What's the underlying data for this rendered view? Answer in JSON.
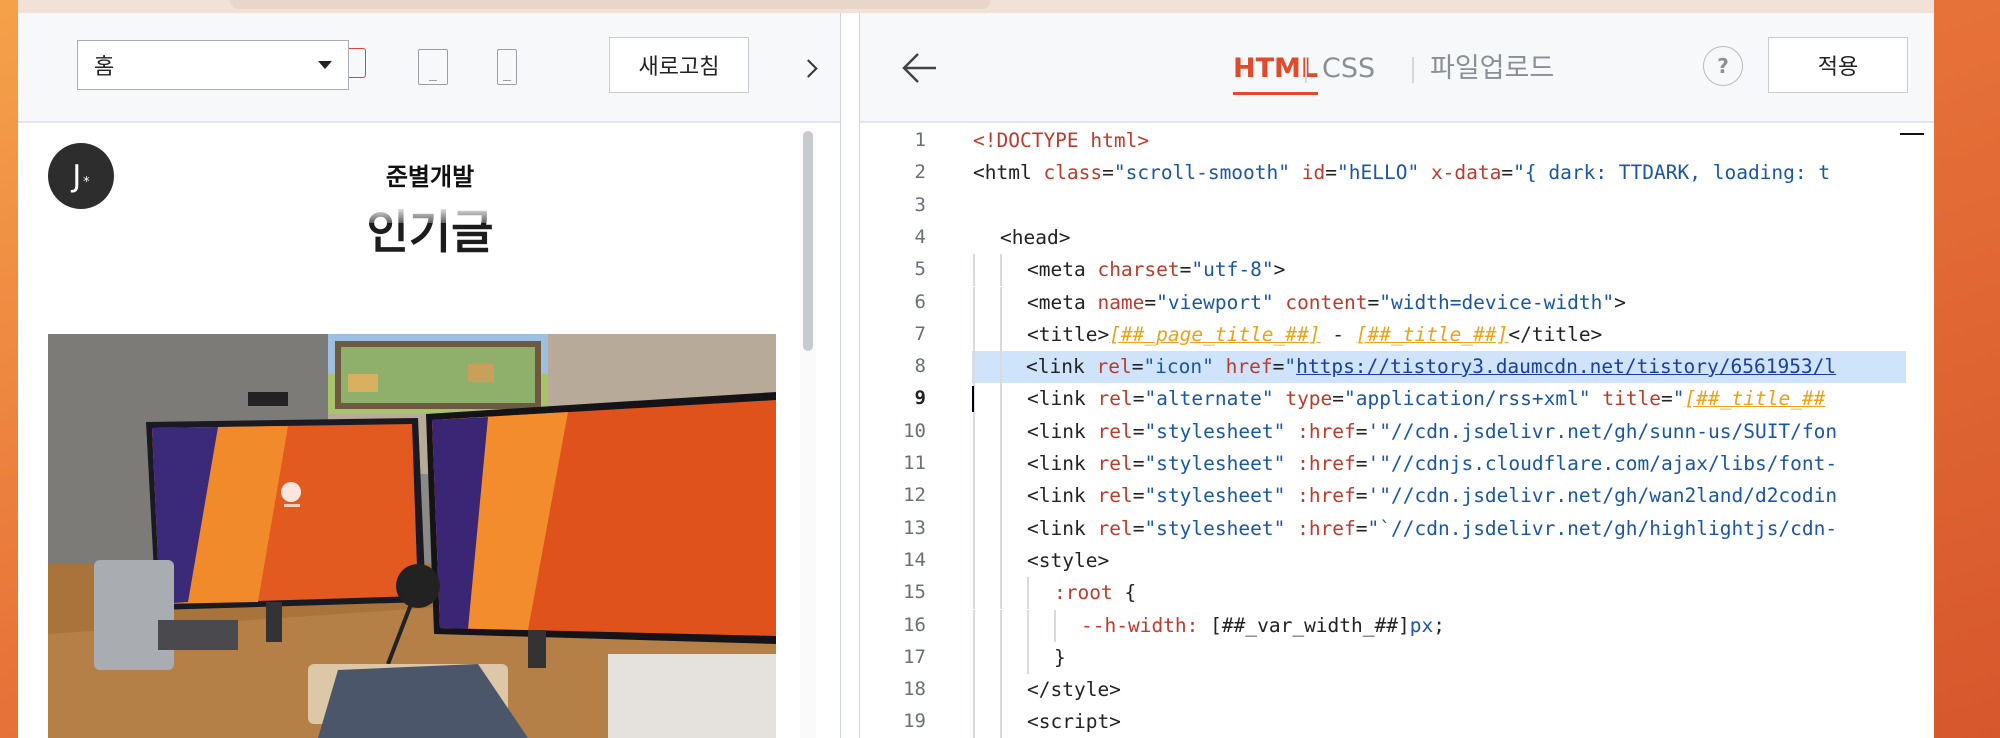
{
  "preview": {
    "page_select": "홈",
    "refresh_label": "새로고침",
    "avatar_text": "J",
    "avatar_sub": "*",
    "blog_title": "준별개발",
    "section_heading": "인기글"
  },
  "editor": {
    "tabs": [
      {
        "label": "HTML",
        "active": true
      },
      {
        "label": "CSS",
        "active": false
      },
      {
        "label": "파일업로드",
        "active": false
      }
    ],
    "help_label": "?",
    "apply_label": "적용",
    "active_line": 9,
    "highlight_line": 8,
    "lines": [
      {
        "n": 1,
        "indent": 0,
        "tokens": [
          [
            "doctype",
            "<!DOCTYPE html>"
          ]
        ]
      },
      {
        "n": 2,
        "indent": 0,
        "tokens": [
          [
            "tag",
            "<html "
          ],
          [
            "attr",
            "class"
          ],
          [
            "plain",
            "="
          ],
          [
            "str",
            "\"scroll-smooth\""
          ],
          [
            "plain",
            " "
          ],
          [
            "attr",
            "id"
          ],
          [
            "plain",
            "="
          ],
          [
            "str",
            "\"hELLO\""
          ],
          [
            "plain",
            " "
          ],
          [
            "attr",
            "x-data"
          ],
          [
            "plain",
            "="
          ],
          [
            "str",
            "\"{ dark: TTDARK, loading: t"
          ]
        ]
      },
      {
        "n": 3,
        "indent": 0,
        "tokens": []
      },
      {
        "n": 4,
        "indent": 1,
        "tokens": [
          [
            "tag",
            "<head>"
          ]
        ]
      },
      {
        "n": 5,
        "indent": 2,
        "tokens": [
          [
            "tag",
            "<meta "
          ],
          [
            "attr",
            "charset"
          ],
          [
            "plain",
            "="
          ],
          [
            "str",
            "\"utf-8\""
          ],
          [
            "tag",
            ">"
          ]
        ]
      },
      {
        "n": 6,
        "indent": 2,
        "tokens": [
          [
            "tag",
            "<meta "
          ],
          [
            "attr",
            "name"
          ],
          [
            "plain",
            "="
          ],
          [
            "str",
            "\"viewport\""
          ],
          [
            "plain",
            " "
          ],
          [
            "attr",
            "content"
          ],
          [
            "plain",
            "="
          ],
          [
            "str",
            "\"width=device-width\""
          ],
          [
            "tag",
            ">"
          ]
        ]
      },
      {
        "n": 7,
        "indent": 2,
        "tokens": [
          [
            "tag",
            "<title>"
          ],
          [
            "tpl",
            "[##_page_title_##]"
          ],
          [
            "plain",
            " - "
          ],
          [
            "tpl",
            "[##_title_##]"
          ],
          [
            "tag",
            "</title>"
          ]
        ]
      },
      {
        "n": 8,
        "indent": 2,
        "tokens": [
          [
            "tag",
            "<link "
          ],
          [
            "attr",
            "rel"
          ],
          [
            "plain",
            "="
          ],
          [
            "str",
            "\"icon\""
          ],
          [
            "plain",
            " "
          ],
          [
            "attr",
            "href"
          ],
          [
            "plain",
            "="
          ],
          [
            "str",
            "\""
          ],
          [
            "link",
            "https://tistory3.daumcdn.net/tistory/6561953/l"
          ]
        ]
      },
      {
        "n": 9,
        "indent": 2,
        "tokens": [
          [
            "tag",
            "<link "
          ],
          [
            "attr",
            "rel"
          ],
          [
            "plain",
            "="
          ],
          [
            "str",
            "\"alternate\""
          ],
          [
            "plain",
            " "
          ],
          [
            "attr",
            "type"
          ],
          [
            "plain",
            "="
          ],
          [
            "str",
            "\"application/rss+xml\""
          ],
          [
            "plain",
            " "
          ],
          [
            "attr",
            "title"
          ],
          [
            "plain",
            "="
          ],
          [
            "str",
            "\""
          ],
          [
            "tpl",
            "[##_title_##"
          ]
        ]
      },
      {
        "n": 10,
        "indent": 2,
        "tokens": [
          [
            "tag",
            "<link "
          ],
          [
            "attr",
            "rel"
          ],
          [
            "plain",
            "="
          ],
          [
            "str",
            "\"stylesheet\""
          ],
          [
            "plain",
            " "
          ],
          [
            "attr",
            ":href"
          ],
          [
            "plain",
            "="
          ],
          [
            "str",
            "'\"//cdn.jsdelivr.net/gh/sunn-us/SUIT/fon"
          ]
        ]
      },
      {
        "n": 11,
        "indent": 2,
        "tokens": [
          [
            "tag",
            "<link "
          ],
          [
            "attr",
            "rel"
          ],
          [
            "plain",
            "="
          ],
          [
            "str",
            "\"stylesheet\""
          ],
          [
            "plain",
            " "
          ],
          [
            "attr",
            ":href"
          ],
          [
            "plain",
            "="
          ],
          [
            "str",
            "'\"//cdnjs.cloudflare.com/ajax/libs/font-"
          ]
        ]
      },
      {
        "n": 12,
        "indent": 2,
        "tokens": [
          [
            "tag",
            "<link "
          ],
          [
            "attr",
            "rel"
          ],
          [
            "plain",
            "="
          ],
          [
            "str",
            "\"stylesheet\""
          ],
          [
            "plain",
            " "
          ],
          [
            "attr",
            ":href"
          ],
          [
            "plain",
            "="
          ],
          [
            "str",
            "'\"//cdn.jsdelivr.net/gh/wan2land/d2codin"
          ]
        ]
      },
      {
        "n": 13,
        "indent": 2,
        "tokens": [
          [
            "tag",
            "<link "
          ],
          [
            "attr",
            "rel"
          ],
          [
            "plain",
            "="
          ],
          [
            "str",
            "\"stylesheet\""
          ],
          [
            "plain",
            " "
          ],
          [
            "attr",
            ":href"
          ],
          [
            "plain",
            "="
          ],
          [
            "str",
            "\"`//cdn.jsdelivr.net/gh/highlightjs/cdn-"
          ]
        ]
      },
      {
        "n": 14,
        "indent": 2,
        "tokens": [
          [
            "tag",
            "<style>"
          ]
        ]
      },
      {
        "n": 15,
        "indent": 3,
        "tokens": [
          [
            "prop",
            ":root"
          ],
          [
            "plain",
            " {"
          ]
        ]
      },
      {
        "n": 16,
        "indent": 4,
        "tokens": [
          [
            "prop",
            "--h-width:"
          ],
          [
            "plain",
            " [##_var_width_##]"
          ],
          [
            "num",
            "px"
          ],
          [
            "plain",
            ";"
          ]
        ]
      },
      {
        "n": 17,
        "indent": 3,
        "tokens": [
          [
            "plain",
            "}"
          ]
        ]
      },
      {
        "n": 18,
        "indent": 2,
        "tokens": [
          [
            "tag",
            "</style>"
          ]
        ]
      },
      {
        "n": 19,
        "indent": 2,
        "tokens": [
          [
            "tag",
            "<script>"
          ]
        ]
      }
    ]
  },
  "colors": {
    "accent": "#e14b2b",
    "highlight": "#cfe3fb",
    "template_var": "#e8a317"
  }
}
